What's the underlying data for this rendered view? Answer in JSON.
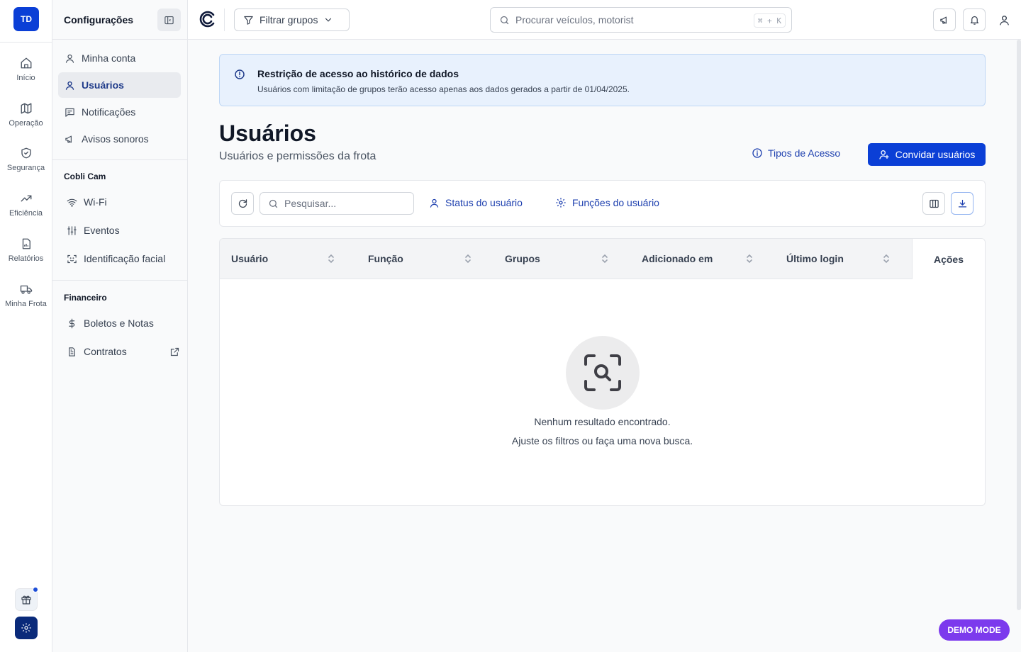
{
  "rail": {
    "avatar": "TD",
    "items": [
      {
        "label": "Início",
        "icon": "home-icon"
      },
      {
        "label": "Operação",
        "icon": "map-icon"
      },
      {
        "label": "Segurança",
        "icon": "shield-icon"
      },
      {
        "label": "Eficiência",
        "icon": "trending-up-icon"
      },
      {
        "label": "Relatórios",
        "icon": "report-icon"
      },
      {
        "label": "Minha Frota",
        "icon": "truck-icon"
      }
    ]
  },
  "sidebar": {
    "title": "Configurações",
    "items": [
      {
        "label": "Minha conta"
      },
      {
        "label": "Usuários",
        "active": true
      },
      {
        "label": "Notificações"
      },
      {
        "label": "Avisos sonoros"
      }
    ],
    "section_cam": "Cobli Cam",
    "cam_items": [
      {
        "label": "Wi-Fi"
      },
      {
        "label": "Eventos"
      },
      {
        "label": "Identificação facial"
      }
    ],
    "section_fin": "Financeiro",
    "fin_items": [
      {
        "label": "Boletos e Notas"
      },
      {
        "label": "Contratos"
      }
    ]
  },
  "topbar": {
    "filter_label": "Filtrar grupos",
    "search_placeholder": "Procurar veículos, motorist",
    "shortcut": "⌘ + K"
  },
  "banner": {
    "title": "Restrição de acesso ao histórico de dados",
    "body": "Usuários com limitação de grupos terão acesso apenas aos dados gerados a partir de 01/04/2025."
  },
  "page": {
    "title": "Usuários",
    "subtitle": "Usuários e permissões da frota",
    "tipos_label": "Tipos de Acesso",
    "invite_label": "Convidar usuários"
  },
  "toolbar": {
    "search_placeholder": "Pesquisar...",
    "status_label": "Status do usuário",
    "roles_label": "Funções do usuário"
  },
  "table": {
    "columns": [
      "Usuário",
      "Função",
      "Grupos",
      "Adicionado em",
      "Último login"
    ],
    "actions": "Ações",
    "empty_title": "Nenhum resultado encontrado.",
    "empty_hint": "Ajuste os filtros ou faça uma nova busca."
  },
  "demo_badge": "DEMO MODE",
  "colors": {
    "brand": "#0b3fd6",
    "link": "#1e40af",
    "demo": "#7c3aed",
    "banner_bg": "#e8f1fd"
  }
}
